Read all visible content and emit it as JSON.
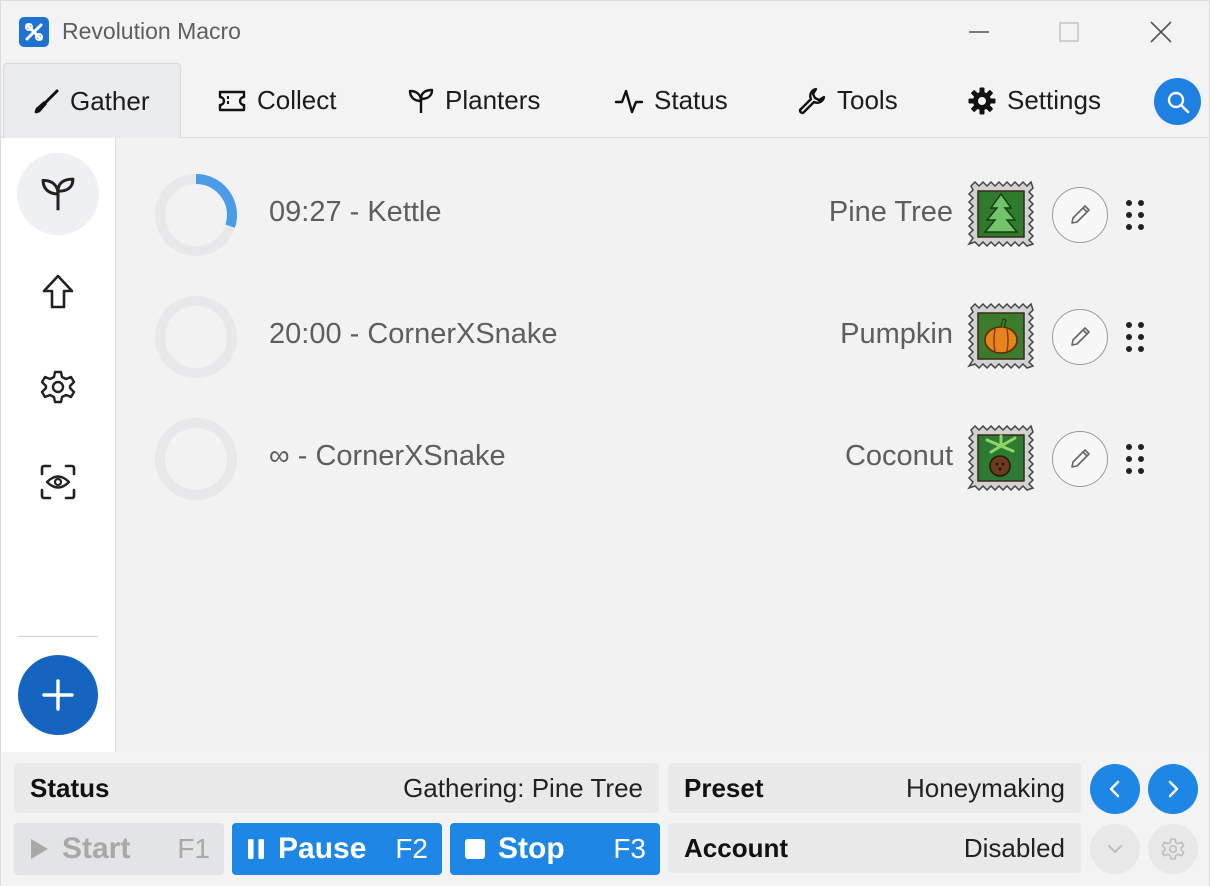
{
  "window": {
    "title": "Revolution Macro",
    "app_icon": "revolution-logo-icon",
    "accent_color": "#1e86e5"
  },
  "tabs": [
    {
      "label": "Gather",
      "icon": "shovel-icon",
      "active": true
    },
    {
      "label": "Collect",
      "icon": "ticket-icon"
    },
    {
      "label": "Planters",
      "icon": "sprout-icon"
    },
    {
      "label": "Status",
      "icon": "pulse-icon"
    },
    {
      "label": "Tools",
      "icon": "wrench-icon"
    },
    {
      "label": "Settings",
      "icon": "gear-icon"
    }
  ],
  "sidebar": {
    "items": [
      {
        "icon": "sprout-icon",
        "active": true
      },
      {
        "icon": "arrow-up-icon"
      },
      {
        "icon": "gear-icon"
      },
      {
        "icon": "eye-scan-icon"
      }
    ],
    "add_icon": "plus-icon"
  },
  "gather_list": [
    {
      "text": "09:27 - Kettle",
      "field": "Pine Tree",
      "stamp": "pine-tree-stamp-icon",
      "progress": 0.3
    },
    {
      "text": "20:00 - CornerXSnake",
      "field": "Pumpkin",
      "stamp": "pumpkin-stamp-icon",
      "progress": 0
    },
    {
      "text": "∞ - CornerXSnake",
      "field": "Coconut",
      "stamp": "coconut-stamp-icon",
      "progress": 0
    }
  ],
  "status_bar": {
    "status_label": "Status",
    "status_value": "Gathering: Pine Tree",
    "preset_label": "Preset",
    "preset_value": "Honeymaking",
    "account_label": "Account",
    "account_value": "Disabled"
  },
  "controls": {
    "start": {
      "label": "Start",
      "key": "F1",
      "enabled": false
    },
    "pause": {
      "label": "Pause",
      "key": "F2",
      "enabled": true
    },
    "stop": {
      "label": "Stop",
      "key": "F3",
      "enabled": true
    }
  }
}
